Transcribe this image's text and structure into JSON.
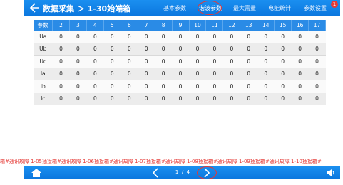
{
  "header": {
    "title": "数据采集 ＞ 1-30始端箱",
    "tabs": [
      {
        "label": "基本参数"
      },
      {
        "label": "谐波参数"
      },
      {
        "label": "最大需量"
      },
      {
        "label": "电能统计"
      },
      {
        "label": "参数设置"
      }
    ],
    "badge": "1"
  },
  "table": {
    "columns": [
      "参数",
      "2",
      "3",
      "4",
      "5",
      "6",
      "7",
      "8",
      "9",
      "10",
      "11",
      "12",
      "13",
      "14",
      "15",
      "16",
      "17"
    ],
    "rows": [
      {
        "name": "Ua",
        "values": [
          "0",
          "0",
          "0",
          "0",
          "0",
          "0",
          "0",
          "0",
          "0",
          "0",
          "0",
          "0",
          "0",
          "0",
          "0",
          "0"
        ]
      },
      {
        "name": "Ub",
        "values": [
          "0",
          "0",
          "0",
          "0",
          "0",
          "0",
          "0",
          "0",
          "0",
          "0",
          "0",
          "0",
          "0",
          "0",
          "0",
          "0"
        ]
      },
      {
        "name": "Uc",
        "values": [
          "0",
          "0",
          "0",
          "0",
          "0",
          "0",
          "0",
          "0",
          "0",
          "0",
          "0",
          "0",
          "0",
          "0",
          "0",
          "0"
        ]
      },
      {
        "name": "Ia",
        "values": [
          "0",
          "0",
          "0",
          "0",
          "0",
          "0",
          "0",
          "0",
          "0",
          "0",
          "0",
          "0",
          "0",
          "0",
          "0",
          "0"
        ]
      },
      {
        "name": "Ib",
        "values": [
          "0",
          "0",
          "0",
          "0",
          "0",
          "0",
          "0",
          "0",
          "0",
          "0",
          "0",
          "0",
          "0",
          "0",
          "0",
          "0"
        ]
      },
      {
        "name": "Ic",
        "values": [
          "0",
          "0",
          "0",
          "0",
          "0",
          "0",
          "0",
          "0",
          "0",
          "0",
          "0",
          "0",
          "0",
          "0",
          "0",
          "0"
        ]
      }
    ]
  },
  "ticker": {
    "text": "箱#通讯故障  1-05插接箱#通讯故障  1-06插接箱#通讯故障  1-07插接箱#通讯故障  1-08插接箱#通讯故障  1-09插接箱#通讯故障  1-10插接箱#"
  },
  "footer": {
    "page_current": "1",
    "page_sep": "/",
    "page_total": "4"
  },
  "colors": {
    "accent": "#0b76de",
    "alarm": "#e53935"
  }
}
